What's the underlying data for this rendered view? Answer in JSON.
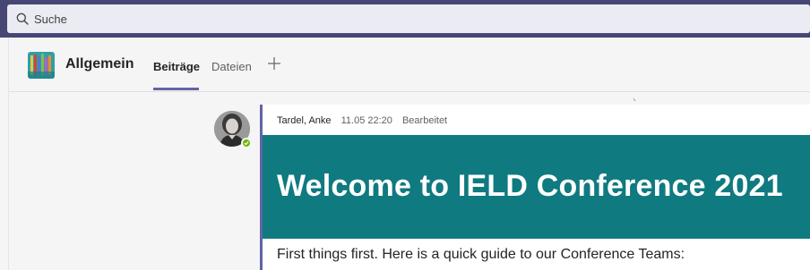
{
  "search": {
    "placeholder": "Suche"
  },
  "channel": {
    "name": "Allgemein",
    "tabs": [
      {
        "label": "Beiträge",
        "active": true
      },
      {
        "label": "Dateien",
        "active": false
      }
    ]
  },
  "message": {
    "author": "Tardel, Anke",
    "timestamp": "11.05 22:20",
    "edited_label": "Bearbeitet",
    "banner_title": "Welcome to IELD Conference 2021",
    "body": "First things first. Here is a quick guide to our Conference Teams:",
    "presence": "available"
  },
  "icons": {
    "search": "search-icon",
    "add_tab": "plus-icon",
    "presence": "check-icon",
    "team_logo": "team-logo"
  },
  "colors": {
    "header_bar": "#464775",
    "accent": "#6264a7",
    "banner": "#0f7a80",
    "presence_available": "#6bb700"
  }
}
